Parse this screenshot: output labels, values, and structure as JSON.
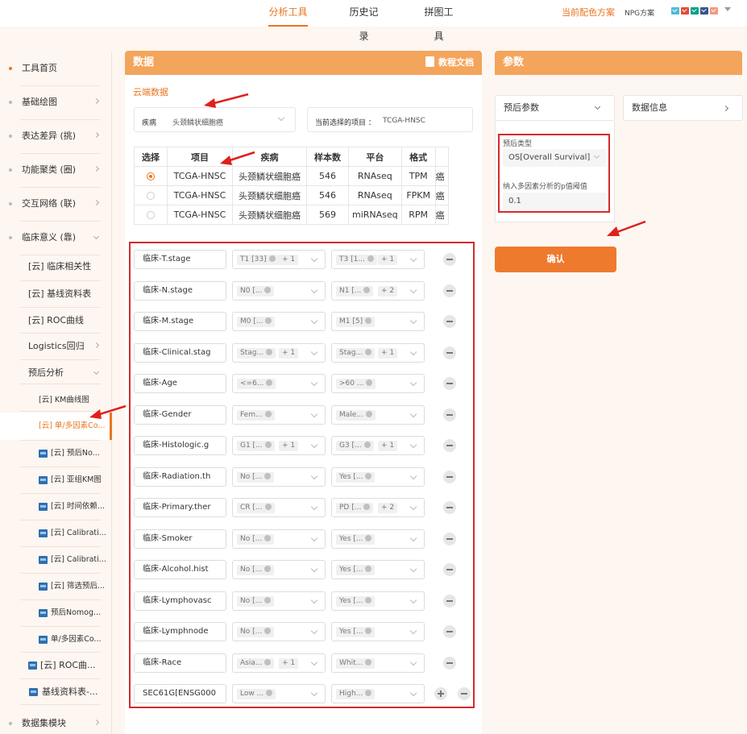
{
  "top_nav": {
    "tabs": [
      {
        "label": "分析工具",
        "active": true
      },
      {
        "label": "历史记录",
        "active": false
      },
      {
        "label": "拼图工具",
        "active": false
      }
    ],
    "scheme_label": "当前配色方案",
    "scheme_name": "NPG方案",
    "swatch_colors": [
      "#4dbbd5",
      "#e64b35",
      "#00a087",
      "#3c5488",
      "#f39b7f"
    ]
  },
  "sidebar": {
    "items": [
      {
        "label": "工具首页"
      },
      {
        "label": "基础绘图"
      },
      {
        "label": "表达差异 (挑)"
      },
      {
        "label": "功能聚类 (圈)"
      },
      {
        "label": "交互网络 (联)"
      },
      {
        "label": "临床意义 (靠)"
      },
      {
        "label": "[云] 临床相关性"
      },
      {
        "label": "[云] 基线资料表"
      },
      {
        "label": "[云] ROC曲线"
      },
      {
        "label": "Logistics回归"
      },
      {
        "label": "预后分析"
      },
      {
        "label": "[云] KM曲线图"
      },
      {
        "label": "[云] 单/多因素Co..."
      },
      {
        "label": "[云] 预后No..."
      },
      {
        "label": "[云] 亚组KM图"
      },
      {
        "label": "[云] 时间依赖..."
      },
      {
        "label": "[云] Calibrati..."
      },
      {
        "label": "[云] Calibrati..."
      },
      {
        "label": "[云] 筛选预后..."
      },
      {
        "label": "预后Nomog..."
      },
      {
        "label": "单/多因素Co..."
      },
      {
        "label": "[云] ROC曲..."
      },
      {
        "label": "基线资料表-..."
      },
      {
        "label": "数据集模块"
      }
    ]
  },
  "data_panel": {
    "title": "数据",
    "doc_link": "教程文档",
    "cloud_label": "云端数据",
    "disease_label": "疾病",
    "disease_value": "头颈鳞状细胞癌",
    "current_label": "当前选择的项目 ：",
    "current_value": "TCGA-HNSC",
    "table": {
      "headers": [
        "选择",
        "项目",
        "疾病",
        "样本数",
        "平台",
        "格式",
        "..."
      ],
      "rows": [
        {
          "selected": true,
          "project": "TCGA-HNSC",
          "disease": "头颈鳞状细胞癌",
          "samples": "546",
          "platform": "RNAseq",
          "format": "TPM",
          "extra": "癌"
        },
        {
          "selected": false,
          "project": "TCGA-HNSC",
          "disease": "头颈鳞状细胞癌",
          "samples": "546",
          "platform": "RNAseq",
          "format": "FPKM",
          "extra": "癌"
        },
        {
          "selected": false,
          "project": "TCGA-HNSC",
          "disease": "头颈鳞状细胞癌",
          "samples": "569",
          "platform": "miRNAseq",
          "format": "RPM",
          "extra": "癌"
        }
      ]
    },
    "filters": [
      {
        "name": "临床-T.stage",
        "a": "T1 [33]",
        "a_more": "+ 1",
        "b": "T3 [1...",
        "b_more": "+ 1"
      },
      {
        "name": "临床-N.stage",
        "a": "N0 [...",
        "a_more": "",
        "b": "N1 [...",
        "b_more": "+ 2"
      },
      {
        "name": "临床-M.stage",
        "a": "M0 [...",
        "a_more": "",
        "b": "M1 [5]",
        "b_more": ""
      },
      {
        "name": "临床-Clinical.stag",
        "a": "Stag...",
        "a_more": "+ 1",
        "b": "Stag...",
        "b_more": "+ 1"
      },
      {
        "name": "临床-Age",
        "a": "<=6...",
        "a_more": "",
        "b": ">60 ...",
        "b_more": ""
      },
      {
        "name": "临床-Gender",
        "a": "Fem...",
        "a_more": "",
        "b": "Male...",
        "b_more": ""
      },
      {
        "name": "临床-Histologic.g",
        "a": "G1 [...",
        "a_more": "+ 1",
        "b": "G3 [...",
        "b_more": "+ 1"
      },
      {
        "name": "临床-Radiation.th",
        "a": "No [...",
        "a_more": "",
        "b": "Yes [...",
        "b_more": ""
      },
      {
        "name": "临床-Primary.ther",
        "a": "CR [...",
        "a_more": "",
        "b": "PD [...",
        "b_more": "+ 2"
      },
      {
        "name": "临床-Smoker",
        "a": "No [...",
        "a_more": "",
        "b": "Yes [...",
        "b_more": ""
      },
      {
        "name": "临床-Alcohol.hist",
        "a": "No [...",
        "a_more": "",
        "b": "Yes [...",
        "b_more": ""
      },
      {
        "name": "临床-Lymphovasc",
        "a": "No [...",
        "a_more": "",
        "b": "Yes [...",
        "b_more": ""
      },
      {
        "name": "临床-Lymphnode",
        "a": "No [...",
        "a_more": "",
        "b": "Yes [...",
        "b_more": ""
      },
      {
        "name": "临床-Race",
        "a": "Asia...",
        "a_more": "+ 1",
        "b": "Whit...",
        "b_more": ""
      },
      {
        "name": "SEC61G[ENSG000",
        "a": "Low ...",
        "a_more": "",
        "b": "High...",
        "b_more": ""
      }
    ]
  },
  "params_panel": {
    "title": "参数",
    "tab_prognosis": "预后参数",
    "tab_data_info": "数据信息",
    "prognosis_type_label": "预后类型",
    "prognosis_type_value": "OS[Overall Survival]",
    "pvalue_label": "纳入多因素分析的p值阈值",
    "pvalue_value": "0.1",
    "confirm_label": "确认"
  },
  "colors": {
    "accent": "#e9751f",
    "header": "#f4a55c",
    "highlight_red": "#d62a2a",
    "button": "#ee7a2e"
  }
}
